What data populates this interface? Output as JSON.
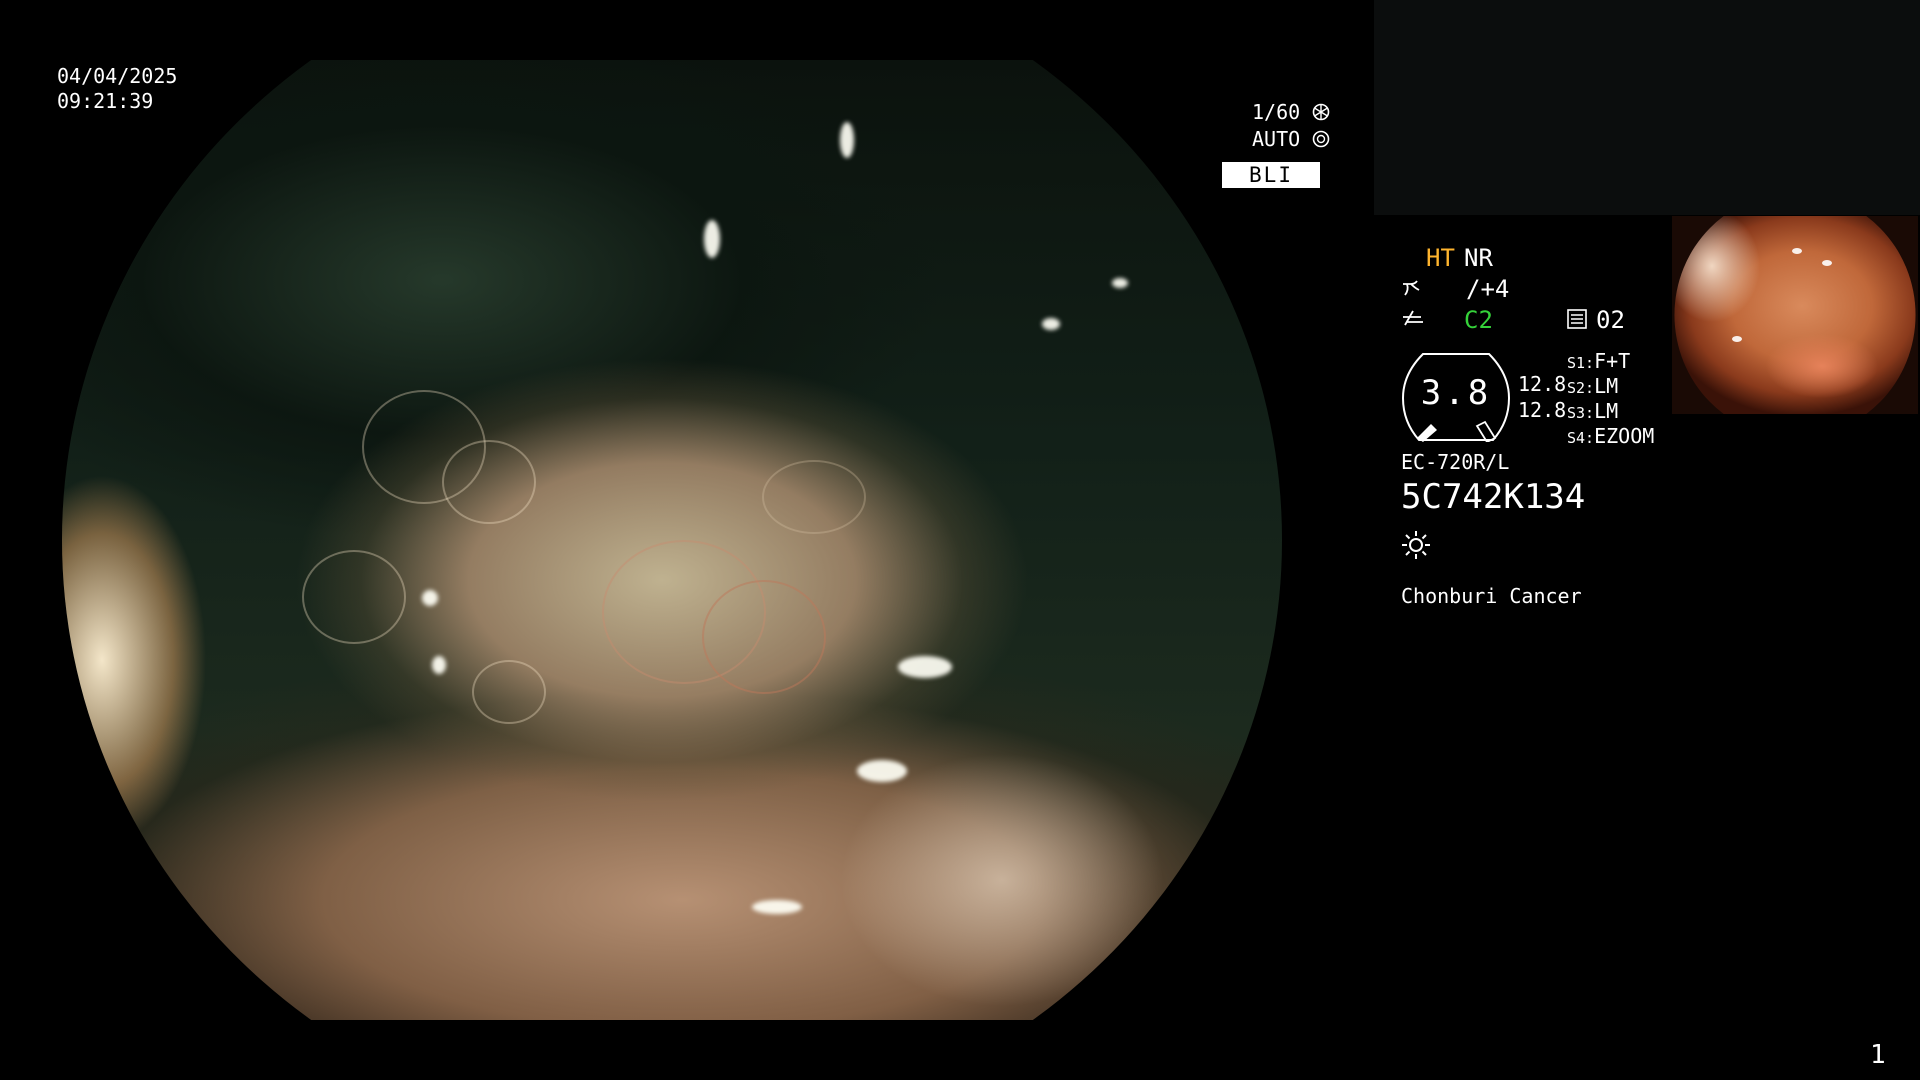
{
  "datetime": {
    "date": "04/04/2025",
    "time": "09:21:39"
  },
  "camera": {
    "shutter": "1/60",
    "shutter_icon": "aperture-icon",
    "exposure": "AUTO",
    "exposure_icon": "iris-icon",
    "mode": "BLI"
  },
  "status": {
    "ht": "HT",
    "nr": "NR",
    "enhance_value": "/+4",
    "color_value": "C2",
    "channel": "02",
    "dial_value": "3.8",
    "dial_left_upper": "12.8",
    "dial_left_lower": "12.8",
    "switches": [
      {
        "label": "S1:",
        "value": "F+T"
      },
      {
        "label": "S2:",
        "value": "LM"
      },
      {
        "label": "S3:",
        "value": "LM"
      },
      {
        "label": "S4:",
        "value": "EZOOM"
      }
    ],
    "scope_model": "EC-720R/L",
    "serial": "5C742K134",
    "light_icon": "sun-icon",
    "institution": "Chonburi Cancer"
  },
  "page_number": "1",
  "colors": {
    "ht": "#ffb52e",
    "c2": "#35d23a",
    "text": "#ffffff",
    "background": "#000000"
  }
}
